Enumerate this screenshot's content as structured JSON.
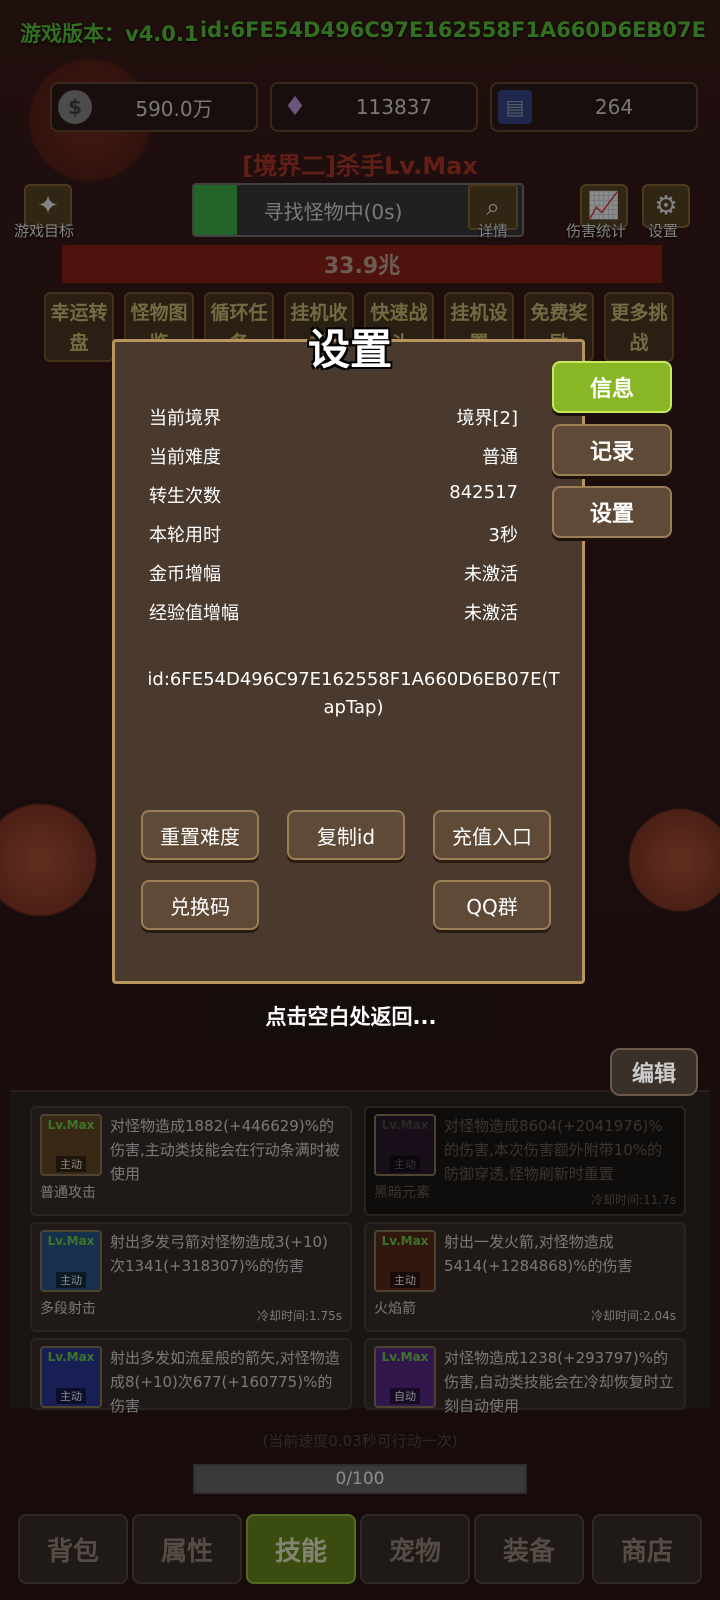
{
  "header": {
    "version": "游戏版本：v4.0.1",
    "id_label": "id:6FE54D496C97E162558F1A660D6EB07E"
  },
  "resources": [
    {
      "icon": "gold-coin-icon",
      "value": "590.0万"
    },
    {
      "icon": "crystal-icon",
      "value": "113837"
    },
    {
      "icon": "card-icon",
      "value": "264"
    }
  ],
  "player_title": "[境界二]杀手Lv.Max",
  "toolbar": {
    "goal_label": "游戏目标",
    "search_text": "寻找怪物中(0s)",
    "search_progress": 0.13,
    "detail_label": "详情",
    "damage_stats_label": "伤害统计",
    "settings_label": "设置"
  },
  "monster_hp": "33.9兆",
  "features": [
    "幸运转盘",
    "怪物图鉴",
    "循环任务",
    "挂机收益",
    "快速战斗",
    "挂机设置",
    "免费奖励",
    "更多挑战"
  ],
  "dialog": {
    "title": "设置",
    "info_rows": [
      {
        "label": "当前境界",
        "value": "境界[2]"
      },
      {
        "label": "当前难度",
        "value": "普通"
      },
      {
        "label": "转生次数",
        "value": "842517"
      },
      {
        "label": "本轮用时",
        "value": "3秒"
      },
      {
        "label": "金币增幅",
        "value": "未激活"
      },
      {
        "label": "经验值增幅",
        "value": "未激活"
      }
    ],
    "id_text": "id:6FE54D496C97E162558F1A660D6EB07E(TapTap)",
    "buttons": {
      "reset_difficulty": "重置难度",
      "copy_id": "复制id",
      "recharge": "充值入口",
      "redeem": "兑换码",
      "qq_group": "QQ群"
    },
    "side_tabs": {
      "info": "信息",
      "record": "记录",
      "settings": "设置"
    }
  },
  "hint": "点击空白处返回...",
  "edit_label": "编辑",
  "skills": [
    {
      "lv": "Lv.Max",
      "mode": "主动",
      "name": "普通攻击",
      "desc": "对怪物造成1882(+446629)%的伤害,主动类技能会在行动条满时被使用",
      "cooldown": ""
    },
    {
      "lv": "Lv.Max",
      "mode": "主动",
      "name": "黑暗元素",
      "desc": "对怪物造成8604(+2041976)%的伤害,本次伤害额外附带10%的防御穿透,怪物刷新时重置",
      "cooldown": "冷却时间:11.7s"
    },
    {
      "lv": "Lv.Max",
      "mode": "主动",
      "name": "多段射击",
      "desc": "射出多发弓箭对怪物造成3(+10)次1341(+318307)%的伤害",
      "cooldown": "冷却时间:1.75s"
    },
    {
      "lv": "Lv.Max",
      "mode": "主动",
      "name": "火焰箭",
      "desc": "射出一发火箭,对怪物造成5414(+1284868)%的伤害",
      "cooldown": "冷却时间:2.04s"
    },
    {
      "lv": "Lv.Max",
      "mode": "主动",
      "name": "",
      "desc": "射出多发如流星般的箭矢,对怪物造成8(+10)次677(+160775)%的伤害",
      "cooldown": ""
    },
    {
      "lv": "Lv.Max",
      "mode": "自动",
      "name": "",
      "desc": "对怪物造成1238(+293797)%的伤害,自动类技能会在冷却恢复时立刻自动使用",
      "cooldown": ""
    }
  ],
  "speed_text": "(当前速度0.03秒可行动一次)",
  "action_progress": "0/100",
  "nav_tabs": [
    "背包",
    "属性",
    "技能",
    "宠物",
    "装备",
    "商店"
  ],
  "colors": {
    "accent_green": "#88b624",
    "version_green": "#5ecb3c",
    "hp_red": "#8e2418"
  }
}
